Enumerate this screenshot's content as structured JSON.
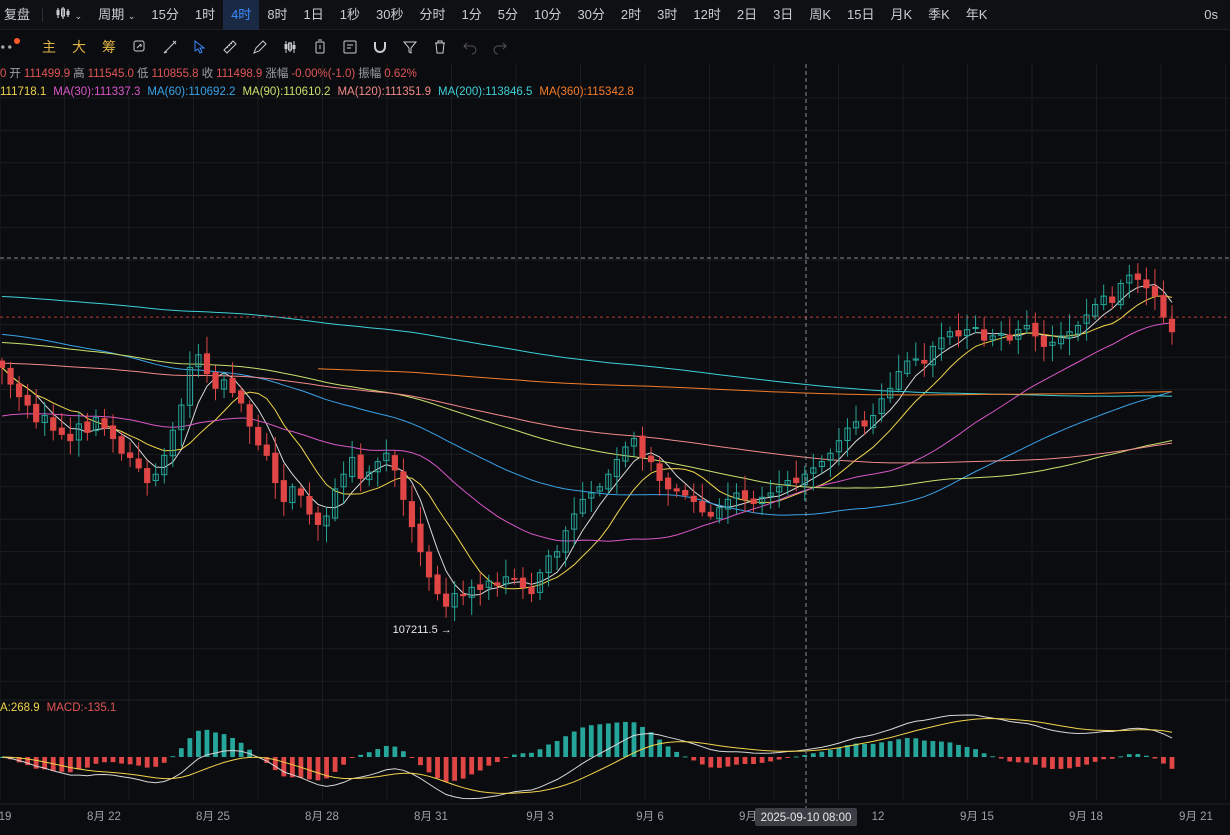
{
  "topbar": {
    "replay_label": "复盘",
    "period_label": "周期",
    "intervals": [
      "15分",
      "1时",
      "4时",
      "8时",
      "1日",
      "1秒",
      "30秒",
      "分时",
      "1分",
      "5分",
      "10分",
      "30分",
      "2时",
      "3时",
      "12时",
      "2日",
      "3日",
      "周K",
      "15日",
      "月K",
      "季K",
      "年K"
    ],
    "active_interval": "4时",
    "right_label": "0s"
  },
  "toolbar": {
    "indicator_labels": [
      "主",
      "大",
      "筹"
    ],
    "tool_icons": [
      "compare-icon",
      "drawing-icon",
      "cursor-icon",
      "ruler-icon",
      "pen-icon",
      "candles-icon",
      "timer-icon",
      "notes-icon",
      "magnet-icon",
      "filter-icon",
      "trash-icon",
      "undo-icon",
      "redo-icon"
    ]
  },
  "ohlc_line": {
    "open_label": "开",
    "open": "111499.9",
    "high_label": "高",
    "high": "111545.0",
    "low_label": "低",
    "low": "110855.8",
    "close_label": "收",
    "close": "111498.9",
    "change_label": "涨幅",
    "change": "-0.00%(-1.0)",
    "amplitude_label": "振幅",
    "amplitude": "0.62%"
  },
  "ma_line": [
    {
      "label": "111718.1",
      "color": "#f1d44b"
    },
    {
      "label": "MA(30):111337.3",
      "color": "#d957c9"
    },
    {
      "label": "MA(60):110692.2",
      "color": "#3aa3e8"
    },
    {
      "label": "MA(90):110610.2",
      "color": "#c9e06d"
    },
    {
      "label": "MA(120):111351.9",
      "color": "#f08a8a"
    },
    {
      "label": "MA(200):113846.5",
      "color": "#3ed0d8"
    },
    {
      "label": "MA(360):115342.8",
      "color": "#f57d2a"
    }
  ],
  "macd_line": [
    {
      "label": "A:268.9",
      "color": "#f1d44b"
    },
    {
      "label": "MACD:-135.1",
      "color": "#e05656"
    }
  ],
  "low_annotation": "107211.5",
  "crosshair_time": "2025-09-10 08:00",
  "colors": {
    "up": "#26a69a",
    "down": "#e04646",
    "background": "#0b0c0f",
    "grid": "#1a1c20"
  },
  "chart_data": {
    "type": "candlestick",
    "x_ticks": [
      "19",
      "8月 22",
      "8月 25",
      "8月 28",
      "8月 31",
      "9月 3",
      "9月 6",
      "9月",
      "12",
      "9月 15",
      "9月 18",
      "9月 21"
    ],
    "x_tick_dates": [
      "08-19",
      "08-22",
      "08-25",
      "08-28",
      "08-31",
      "09-03",
      "09-06",
      "09-09",
      "09-12",
      "09-15",
      "09-18",
      "09-21"
    ],
    "start": "2025-08-19 04:00",
    "bar_hours": 4,
    "closes": [
      113800,
      113400,
      113100,
      112900,
      112500,
      112650,
      112300,
      112200,
      112050,
      112450,
      112250,
      112600,
      112350,
      112100,
      111750,
      111650,
      111400,
      111050,
      111250,
      111700,
      112300,
      112900,
      113800,
      114100,
      113650,
      113300,
      113500,
      113200,
      112950,
      112400,
      111950,
      111700,
      111050,
      110600,
      110950,
      110750,
      110300,
      110050,
      110250,
      110900,
      111250,
      111650,
      111150,
      111300,
      111550,
      111750,
      111350,
      110650,
      110000,
      109400,
      108800,
      108400,
      108100,
      108400,
      108350,
      108550,
      108500,
      108700,
      108600,
      108800,
      108750,
      108550,
      108400,
      108900,
      109300,
      109400,
      109900,
      110300,
      110650,
      110800,
      110950,
      111250,
      111600,
      111900,
      112100,
      111650,
      111550,
      111100,
      110900,
      110850,
      110750,
      110600,
      110350,
      110250,
      110450,
      110650,
      110800,
      110650,
      110550,
      110700,
      110800,
      110950,
      111100,
      111050,
      111250,
      111400,
      111550,
      111750,
      112050,
      112350,
      112500,
      112400,
      112650,
      113050,
      113300,
      113700,
      113950,
      114000,
      113900,
      114300,
      114500,
      114650,
      114550,
      114700,
      114750,
      114450,
      114550,
      114600,
      114450,
      114700,
      114800,
      114550,
      114300,
      114400,
      114550,
      114650,
      114800,
      115050,
      115300,
      115500,
      115350,
      115800,
      116000,
      115900,
      115700,
      115500,
      115000,
      114650
    ],
    "ma_series": [
      {
        "name": "MA(30)",
        "value": 111337.3,
        "color": "#d957c9"
      },
      {
        "name": "MA(60)",
        "value": 110692.2,
        "color": "#3aa3e8"
      },
      {
        "name": "MA(90)",
        "value": 110610.2,
        "color": "#c9e06d"
      },
      {
        "name": "MA(120)",
        "value": 111351.9,
        "color": "#f08a8a"
      },
      {
        "name": "MA(200)",
        "value": 113846.5,
        "color": "#3ed0d8"
      },
      {
        "name": "MA(360)",
        "value": 115342.8,
        "color": "#f57d2a"
      }
    ],
    "annotations": [
      {
        "text": "107211.5",
        "kind": "low"
      }
    ]
  }
}
